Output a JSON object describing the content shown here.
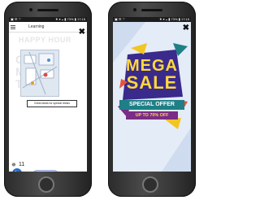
{
  "left_phone": {
    "status": {
      "left": "▣ ☰ ♡",
      "right": "✷ ▾ ◒ ▮ 73% ▮ 17:15"
    },
    "app_bar": {
      "title": "Learning",
      "close_label": "✖"
    },
    "background_text": {
      "headline": "HAPPY HOUR",
      "letters": "GR\nM\nT"
    },
    "tooltip": "Great deals for special drinks",
    "bottom": {
      "bluetooth": "✵",
      "count": "11",
      "play": "▶"
    }
  },
  "right_phone": {
    "status": {
      "left": "▣ ☰ ♡",
      "right": "✷ ▾ ◒ ▮ 73% ▮ 17:15"
    },
    "close_label": "✖",
    "ad": {
      "line1": "MEGA",
      "line2": "SALE",
      "banner1": "SPECIAL OFFER",
      "banner2": "UP TO 70% OFF"
    }
  },
  "colors": {
    "sale_yellow": "#ffd93b",
    "teal": "#1f7f86",
    "purple": "#7a2c86",
    "play_blue": "#2b6cc4"
  }
}
